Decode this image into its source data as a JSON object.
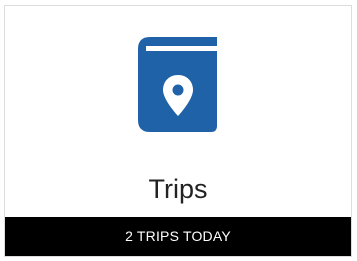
{
  "tile": {
    "title": "Trips",
    "status": "2 TRIPS TODAY",
    "icon": "trip-book-location-pin-icon"
  },
  "colors": {
    "icon": "#1f62a8",
    "title_text": "#222222",
    "footer_background": "#000000",
    "footer_text": "#ffffff",
    "border": "#dcdcdc"
  }
}
